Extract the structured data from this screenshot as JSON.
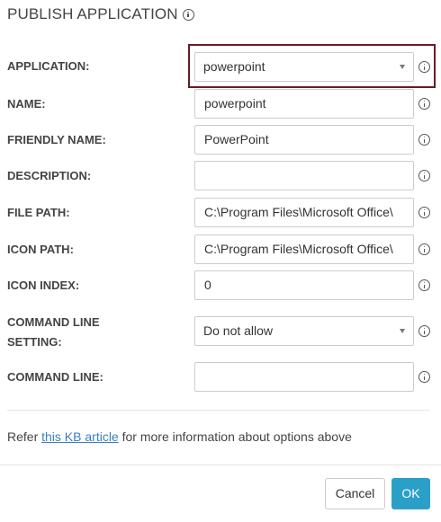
{
  "dialog": {
    "title": "PUBLISH APPLICATION"
  },
  "form": {
    "application": {
      "label": "APPLICATION:",
      "value": "powerpoint"
    },
    "name": {
      "label": "NAME:",
      "value": "powerpoint"
    },
    "friendly_name": {
      "label": "FRIENDLY NAME:",
      "value": "PowerPoint"
    },
    "description": {
      "label": "DESCRIPTION:",
      "value": ""
    },
    "file_path": {
      "label": "FILE PATH:",
      "value": "C:\\Program Files\\Microsoft Office\\"
    },
    "icon_path": {
      "label": "ICON PATH:",
      "value": "C:\\Program Files\\Microsoft Office\\"
    },
    "icon_index": {
      "label": "ICON INDEX:",
      "value": "0"
    },
    "command_line_setting": {
      "label_line1": "COMMAND LINE",
      "label_line2": "SETTING:",
      "value": "Do not allow"
    },
    "command_line": {
      "label": "COMMAND LINE:",
      "value": ""
    }
  },
  "note": {
    "prefix": "Refer ",
    "link": "this KB article",
    "suffix": " for more information about options above"
  },
  "buttons": {
    "cancel": "Cancel",
    "ok": "OK"
  },
  "colors": {
    "highlight_border": "#6b1a24",
    "link": "#3a7fc1",
    "ok_button": "#2aa0c8"
  },
  "icons": [
    "info-icon",
    "chevron-down-icon"
  ]
}
